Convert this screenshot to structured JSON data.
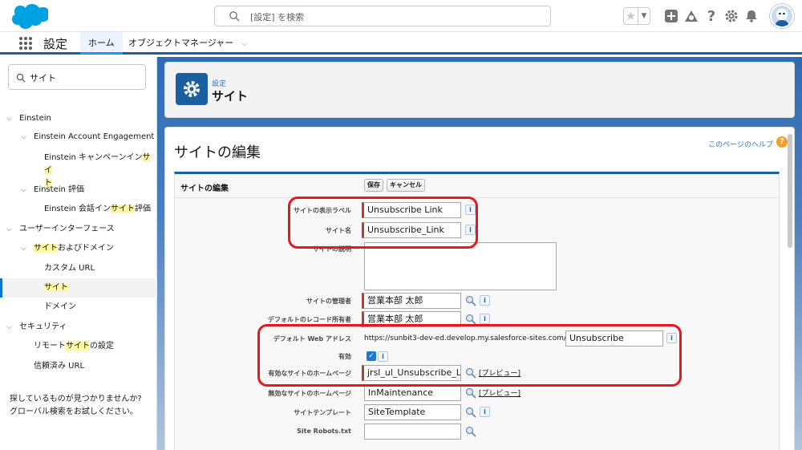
{
  "header": {
    "search_placeholder": "[設定] を検索"
  },
  "appnav": {
    "app_name": "設定",
    "tab_home": "ホーム",
    "tab_object_manager": "オブジェクトマネージャー"
  },
  "sidebar": {
    "quickfind_value": "サイト",
    "tree": {
      "einstein": "Einstein",
      "einstein_account_engagement": "Einstein Account Engagement",
      "campaign_insight_pre": "Einstein キャンペーンイン",
      "campaign_insight_hl1": "サイ",
      "campaign_insight_hl2": "ト",
      "einstein_eval": "Einstein 評価",
      "conv_insight_pre": "Einstein 会話イン",
      "conv_insight_hl": "サイト",
      "conv_insight_post": "評価",
      "user_interface": "ユーザーインターフェース",
      "sites_domains_hl": "サイト",
      "sites_domains_post": "およびドメイン",
      "custom_url": "カスタム URL",
      "sites_hl": "サイト",
      "domains": "ドメイン",
      "security": "セキュリティ",
      "remote_site_pre": "リモート",
      "remote_site_hl": "サイト",
      "remote_site_post": "の設定",
      "trusted_url": "信頼済み URL"
    },
    "no_result_line1": "探しているものが見つかりませんか?",
    "no_result_line2": "グローバル検索をお試しください。"
  },
  "page_header": {
    "breadcrumb": "設定",
    "title": "サイト"
  },
  "edit": {
    "title": "サイトの編集",
    "help_link": "このページのヘルプ",
    "block_title": "サイトの編集",
    "save_button": "保存",
    "cancel_button": "キャンセル",
    "fields": {
      "site_label": {
        "label": "サイトの表示ラベル",
        "value": "Unsubscribe Link"
      },
      "site_name": {
        "label": "サイト名",
        "value": "Unsubscribe_Link"
      },
      "site_description": {
        "label": "サイトの説明",
        "value": ""
      },
      "site_contact": {
        "label": "サイトの管理者",
        "value": "営業本部 太郎"
      },
      "default_record_owner": {
        "label": "デフォルトのレコード所有者",
        "value": "営業本部 太郎"
      },
      "default_web_address": {
        "label": "デフォルト Web アドレス",
        "prefix": "https://sunbit3-dev-ed.develop.my.salesforce-sites.com/",
        "value": "Unsubscribe"
      },
      "active": {
        "label": "有効",
        "checked": true
      },
      "active_home_page": {
        "label": "有効なサイトのホームページ",
        "value": "jrsl_ul_Unsubscribe_Link"
      },
      "inactive_home_page": {
        "label": "無効なサイトのホームページ",
        "value": "InMaintenance"
      },
      "site_template": {
        "label": "サイトテンプレート",
        "value": "SiteTemplate"
      },
      "site_robots": {
        "label": "Site Robots.txt",
        "value": ""
      }
    },
    "preview_link": "[プレビュー]"
  },
  "colors": {
    "brand_blue": "#0176d3",
    "highlight_red": "#e8161e",
    "search_highlight": "#fff8a6"
  }
}
